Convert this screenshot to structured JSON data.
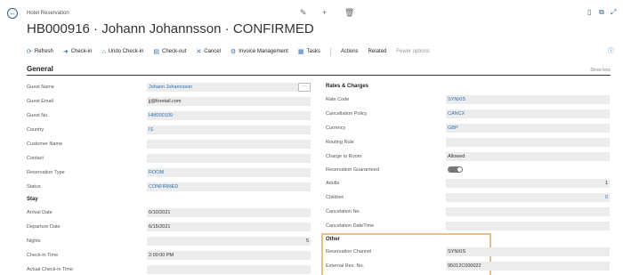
{
  "header": {
    "breadcrumb": "Hotel Reservation",
    "title": "HB000916 · Johann Johannsson · CONFIRMED"
  },
  "actions": {
    "refresh": "Refresh",
    "check_in": "Check-in",
    "undo_check_in": "Undo Check-in",
    "check_out": "Check-out",
    "cancel": "Cancel",
    "invoice_management": "Invoice Management",
    "tasks": "Tasks",
    "actions": "Actions",
    "related": "Related",
    "fewer_options": "Fewer options"
  },
  "general": {
    "title": "General",
    "show_less": "Show less",
    "guest_name": {
      "label": "Guest Name",
      "value": "Johann Johannsson"
    },
    "guest_email": {
      "label": "Guest Email",
      "value": "jj@foretail.com"
    },
    "guest_no": {
      "label": "Guest No.",
      "value": "HM000109"
    },
    "country": {
      "label": "Country",
      "value": "IS"
    },
    "customer_name": {
      "label": "Customer Name",
      "value": ""
    },
    "contact": {
      "label": "Contact",
      "value": ""
    },
    "reservation_type": {
      "label": "Reservation Type",
      "value": "ROOM"
    },
    "status": {
      "label": "Status",
      "value": "CONFIRMED"
    },
    "more_button": "···"
  },
  "stay": {
    "title": "Stay",
    "arrival_date": {
      "label": "Arrival Date",
      "value": "6/10/2021"
    },
    "departure_date": {
      "label": "Departure Date",
      "value": "6/15/2021"
    },
    "nights": {
      "label": "Nights",
      "value": "5"
    },
    "check_in_time": {
      "label": "Check-in Time",
      "value": "2:00:00 PM"
    },
    "actual_check_in_time": {
      "label": "Actual Check-in Time",
      "value": ""
    }
  },
  "rates": {
    "title": "Rates & Charges",
    "rate_code": {
      "label": "Rate Code",
      "value": "SYNXIS"
    },
    "cancellation_policy": {
      "label": "Cancellation Policy",
      "value": "CANCX"
    },
    "currency": {
      "label": "Currency",
      "value": "GBP"
    },
    "routing_rule": {
      "label": "Routing Rule",
      "value": ""
    },
    "charge_to_room": {
      "label": "Charge to Room",
      "value": "Allowed"
    },
    "reservation_guaranteed": {
      "label": "Reservation Guaranteed",
      "value": true
    },
    "adults": {
      "label": "Adults",
      "value": "1"
    },
    "children": {
      "label": "Children",
      "value": "0"
    },
    "cancelation_no": {
      "label": "Cancelation No.",
      "value": ""
    },
    "cancelation_datetime": {
      "label": "Cancelation DateTime",
      "value": ""
    }
  },
  "other": {
    "title": "Other",
    "reservation_channel": {
      "label": "Reservation Channel",
      "value": "SYNXIS"
    },
    "external_res_no": {
      "label": "External Res. No.",
      "value": "95012C000022"
    }
  },
  "colors": {
    "accent": "#2b6fb5",
    "field_bg": "#ececec",
    "highlight": "#e3c382"
  }
}
